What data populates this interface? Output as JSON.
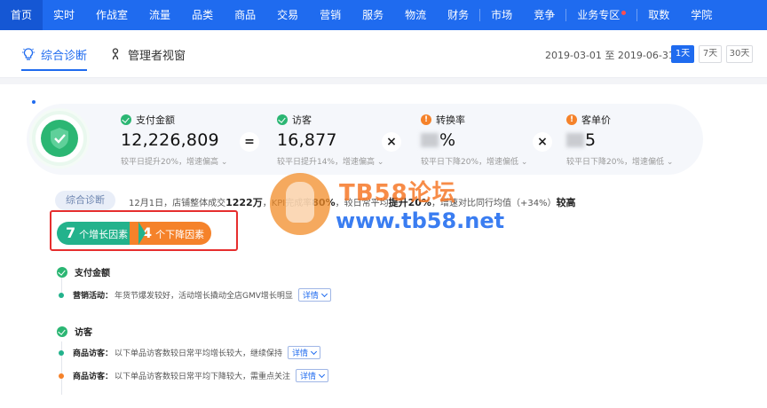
{
  "nav": {
    "items": [
      "首页",
      "实时",
      "作战室",
      "流量",
      "品类",
      "商品",
      "交易",
      "营销",
      "服务",
      "物流",
      "财务",
      "市场",
      "竞争",
      "业务专区",
      "取数",
      "学院"
    ],
    "active_index": 0
  },
  "subnav": {
    "tabs": [
      {
        "label": "综合诊断",
        "icon": "lightbulb-icon"
      },
      {
        "label": "管理者视窗",
        "icon": "person-icon"
      }
    ],
    "active_index": 0,
    "date_range": "2019-03-01 至 2019-06-31",
    "range_buttons": [
      "1天",
      "7天",
      "30天"
    ],
    "range_active_index": 0
  },
  "kpis": [
    {
      "status": "up",
      "title": "支付金额",
      "value": "12,226,809",
      "note": "较平日提升20%，增速偏高 ⌄"
    },
    {
      "status": "up",
      "title": "访客",
      "value": "16,877",
      "note": "较平日提升14%，增速偏高 ⌄"
    },
    {
      "status": "down",
      "title": "转换率",
      "value": "%",
      "note": "较平日下降20%，增速偏低 ⌄"
    },
    {
      "status": "down",
      "title": "客单价",
      "value": "5",
      "note": "较平日下降20%，增速偏低 ⌄"
    }
  ],
  "operators": [
    "=",
    "×",
    "×"
  ],
  "summary": {
    "tag": "综合诊断",
    "text_a": "12月1日，店铺整体成交",
    "amount": "1222万",
    "text_b": "，KPI完成率",
    "rate": "80%",
    "text_c": "，较日常平均",
    "increase": "提升20%",
    "text_d": "，增速对比同行均值（+34%）",
    "level": "较高"
  },
  "factors": {
    "growth_count": "7",
    "growth_label": "个增长因素",
    "decline_count": "4",
    "decline_label": "个下降因素"
  },
  "sections": [
    {
      "title": "支付金额",
      "items": [
        {
          "trend": "up",
          "label": "营销活动：",
          "text": "年货节爆发较好，活动增长撬动全店GMV增长明显",
          "detail": "详情"
        }
      ]
    },
    {
      "title": "访客",
      "items": [
        {
          "trend": "up",
          "label": "商品访客：",
          "text": "以下单品访客数较日常平均增长较大，继续保持",
          "detail": "详情"
        },
        {
          "trend": "down",
          "label": "商品访客：",
          "text": "以下单品访客数较日常平均下降较大，需重点关注",
          "detail": "详情"
        }
      ]
    }
  ],
  "watermark": {
    "title": "TB58论坛",
    "url": "www.tb58.net"
  },
  "colors": {
    "brand_blue": "#1f6bef",
    "growth_green": "#23b28c",
    "decline_orange": "#f5822a",
    "highlight_red": "#e62e2e"
  }
}
